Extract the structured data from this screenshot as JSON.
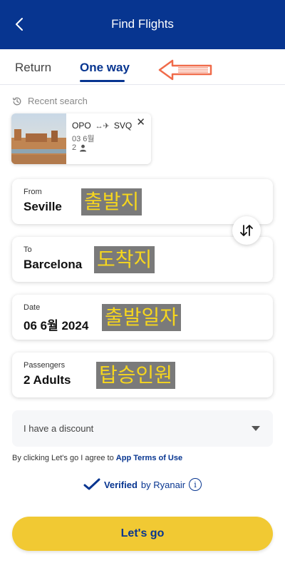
{
  "header": {
    "title": "Find Flights",
    "back_icon": "chevron-left-icon"
  },
  "tabs": [
    {
      "label": "Return",
      "active": false
    },
    {
      "label": "One way",
      "active": true
    }
  ],
  "recent": {
    "label": "Recent search",
    "icon": "history-icon",
    "card": {
      "from": "OPO",
      "to": "SVQ",
      "arrow": "↔✈",
      "date": "03 6월",
      "passengers": "2"
    }
  },
  "fields": {
    "from": {
      "label": "From",
      "value": "Seville",
      "annotation": "출발지"
    },
    "to": {
      "label": "To",
      "value": "Barcelona",
      "annotation": "도착지"
    },
    "date": {
      "label": "Date",
      "value": "06 6월 2024",
      "annotation": "출발일자"
    },
    "passengers": {
      "label": "Passengers",
      "value": "2 Adults",
      "annotation": "탑승인원"
    }
  },
  "discount": {
    "label": "I have a discount"
  },
  "terms": {
    "prefix": "By clicking Let's go I agree to ",
    "link": "App Terms of Use"
  },
  "verified": {
    "bold": "Verified",
    "suffix": "by Ryanair"
  },
  "cta": {
    "label": "Let's go"
  },
  "colors": {
    "brand": "#073590",
    "accent": "#f1c933",
    "annotation_bg": "#7a7a7a",
    "annotation_text": "#f6d61e",
    "arrow": "#f06b4a"
  }
}
